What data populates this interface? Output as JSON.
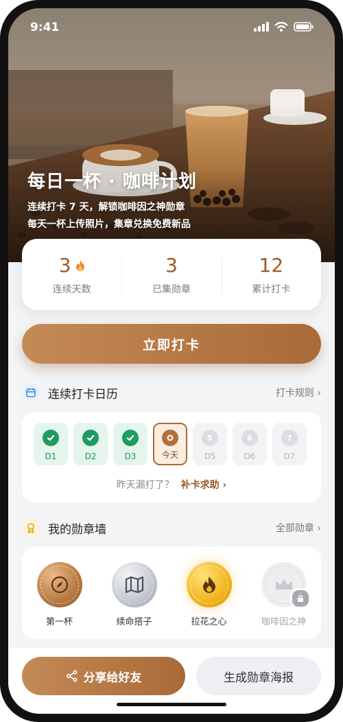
{
  "status": {
    "time": "9:41"
  },
  "hero": {
    "title": "每日一杯 · 咖啡计划",
    "subtitle_line1": "连续打卡 7 天，解锁咖啡因之神勋章",
    "subtitle_line2": "每天一杯上传照片，集章兑换免费新品"
  },
  "stats": [
    {
      "value": "3",
      "label": "连续天数",
      "icon": "flame-icon"
    },
    {
      "value": "3",
      "label": "已集勋章"
    },
    {
      "value": "12",
      "label": "累计打卡"
    }
  ],
  "checkin_button": "立即打卡",
  "calendar": {
    "title": "连续打卡日历",
    "link": "打卡规则 ›",
    "days": [
      {
        "label": "D1",
        "state": "done"
      },
      {
        "label": "D2",
        "state": "done"
      },
      {
        "label": "D3",
        "state": "done"
      },
      {
        "label": "今天",
        "state": "today"
      },
      {
        "label": "D5",
        "num": "5",
        "state": "future"
      },
      {
        "label": "D6",
        "num": "6",
        "state": "future"
      },
      {
        "label": "D7",
        "num": "7",
        "state": "future"
      }
    ],
    "makeup_question": "昨天漏打了？",
    "makeup_action": "补卡求助 ›"
  },
  "badges": {
    "title": "我的勋章墙",
    "link": "全部勋章 ›",
    "items": [
      {
        "label": "第一杯",
        "icon": "compass-icon"
      },
      {
        "label": "续命搭子",
        "icon": "map-icon"
      },
      {
        "label": "拉花之心",
        "icon": "flame-icon"
      },
      {
        "label": "咖啡因之神",
        "icon": "crown-icon",
        "locked": true
      }
    ]
  },
  "bottom": {
    "share": "分享给好友",
    "poster": "生成勋章海报"
  },
  "colors": {
    "accent": "#a86a38",
    "success": "#1f9a63",
    "gold": "#f2b51e"
  }
}
